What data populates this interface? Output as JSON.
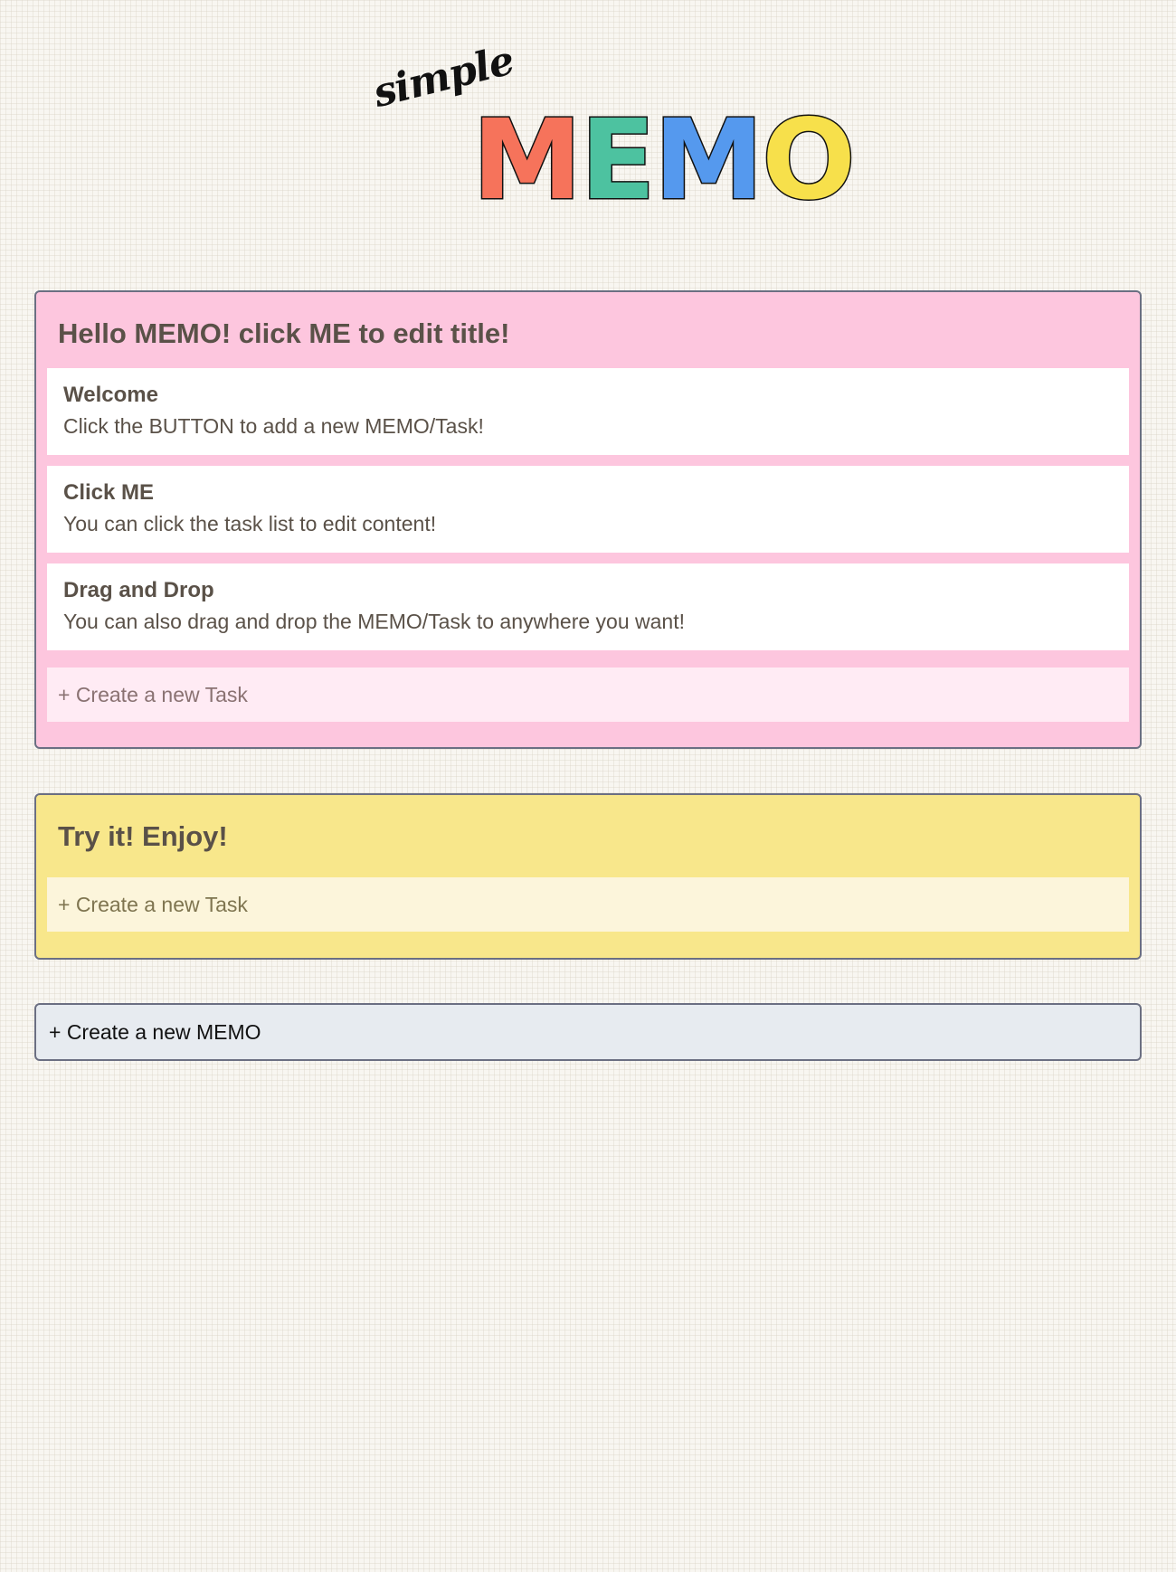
{
  "logo": {
    "small_text": "simple",
    "letters": [
      {
        "char": "M",
        "color": "#f6735b"
      },
      {
        "char": "E",
        "color": "#4dc2a0"
      },
      {
        "char": "M",
        "color": "#5599ee"
      },
      {
        "char": "O",
        "color": "#f7e04b"
      }
    ]
  },
  "memos": [
    {
      "title": "Hello MEMO! click ME to edit title!",
      "background": "#fdc6de",
      "add_task_background": "#ffebf4",
      "add_task_color": "#8a7272",
      "tasks": [
        {
          "title": "Welcome",
          "content": "Click the BUTTON to add a new MEMO/Task!"
        },
        {
          "title": "Click ME",
          "content": "You can click the task list to edit content!"
        },
        {
          "title": "Drag and Drop",
          "content": "You can also drag and drop the MEMO/Task to anywhere you want!"
        }
      ],
      "add_task_label": "+ Create a new Task"
    },
    {
      "title": "Try it! Enjoy!",
      "background": "#f8e78b",
      "add_task_background": "#fcf5db",
      "add_task_color": "#7f7550",
      "tasks": [],
      "add_task_label": "+ Create a new Task"
    }
  ],
  "create_memo_label": "+ Create a new MEMO"
}
